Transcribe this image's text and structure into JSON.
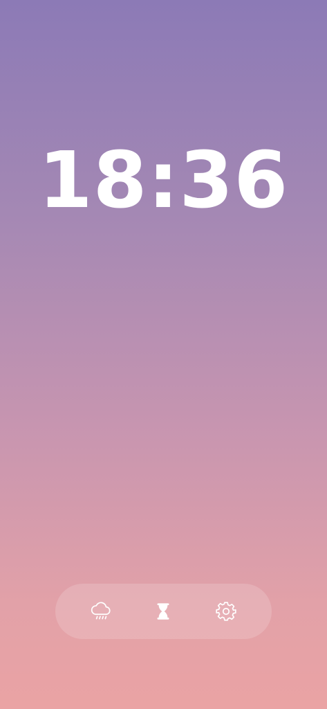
{
  "clock": {
    "time": "18:36"
  },
  "dock": {
    "buttons": [
      {
        "name": "weather",
        "icon": "cloud-rain-icon"
      },
      {
        "name": "timer",
        "icon": "hourglass-icon"
      },
      {
        "name": "settings",
        "icon": "gear-icon"
      }
    ]
  },
  "colors": {
    "gradient_top": "#8C7AB6",
    "gradient_bottom": "#EAA3A4",
    "text": "#FFFFFF"
  }
}
